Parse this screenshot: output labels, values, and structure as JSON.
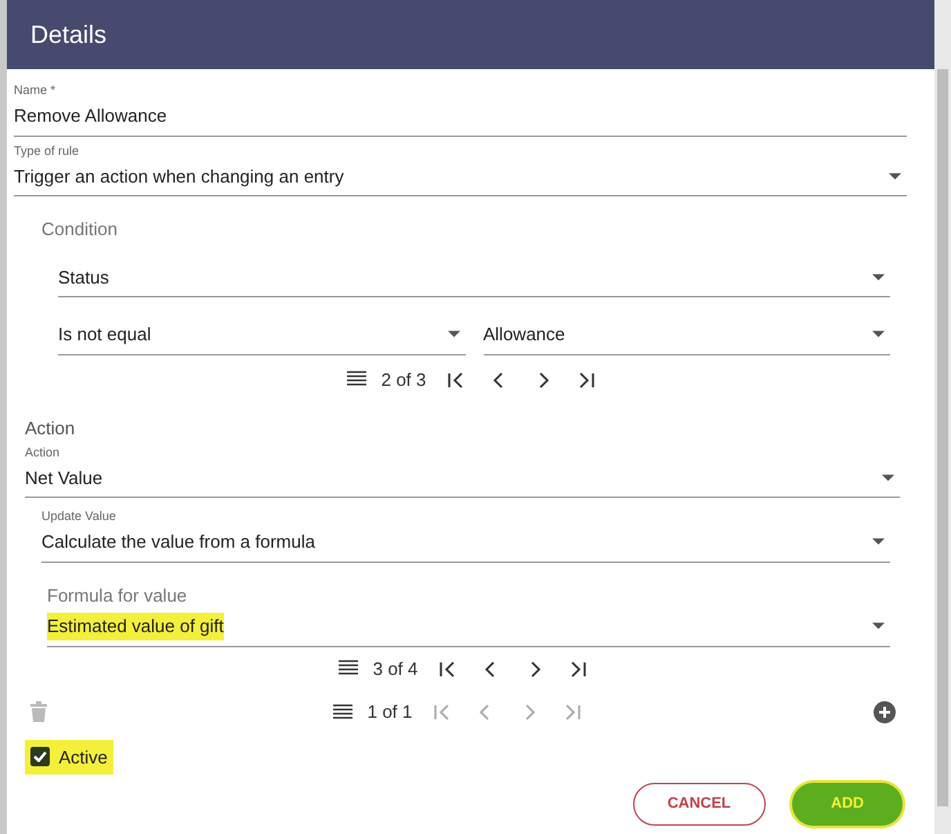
{
  "dialog": {
    "title": "Details"
  },
  "name_field": {
    "label": "Name *",
    "value": "Remove Allowance"
  },
  "rule_type": {
    "label": "Type of rule",
    "value": "Trigger an action when changing an entry"
  },
  "condition": {
    "heading": "Condition",
    "field": {
      "value": "Status"
    },
    "operator": {
      "value": "Is not equal"
    },
    "operand": {
      "value": "Allowance"
    },
    "pager": {
      "text": "2 of 3",
      "disabled": false
    }
  },
  "action": {
    "heading": "Action",
    "action_field": {
      "label": "Action",
      "value": "Net Value"
    },
    "update_field": {
      "label": "Update Value",
      "value": "Calculate the value from a formula"
    },
    "formula_heading": "Formula for value",
    "formula_field": {
      "value": "Estimated value of gift",
      "highlighted": true
    },
    "pager": {
      "text": "3 of 4",
      "disabled": false
    }
  },
  "actions_pager": {
    "text": "1 of 1",
    "disabled": true
  },
  "active": {
    "label": "Active",
    "checked": true,
    "highlighted": true
  },
  "buttons": [
    {
      "label": "CANCEL",
      "kind": "outline",
      "highlighted": false
    },
    {
      "label": "ADD",
      "kind": "primary",
      "highlighted": true
    }
  ]
}
